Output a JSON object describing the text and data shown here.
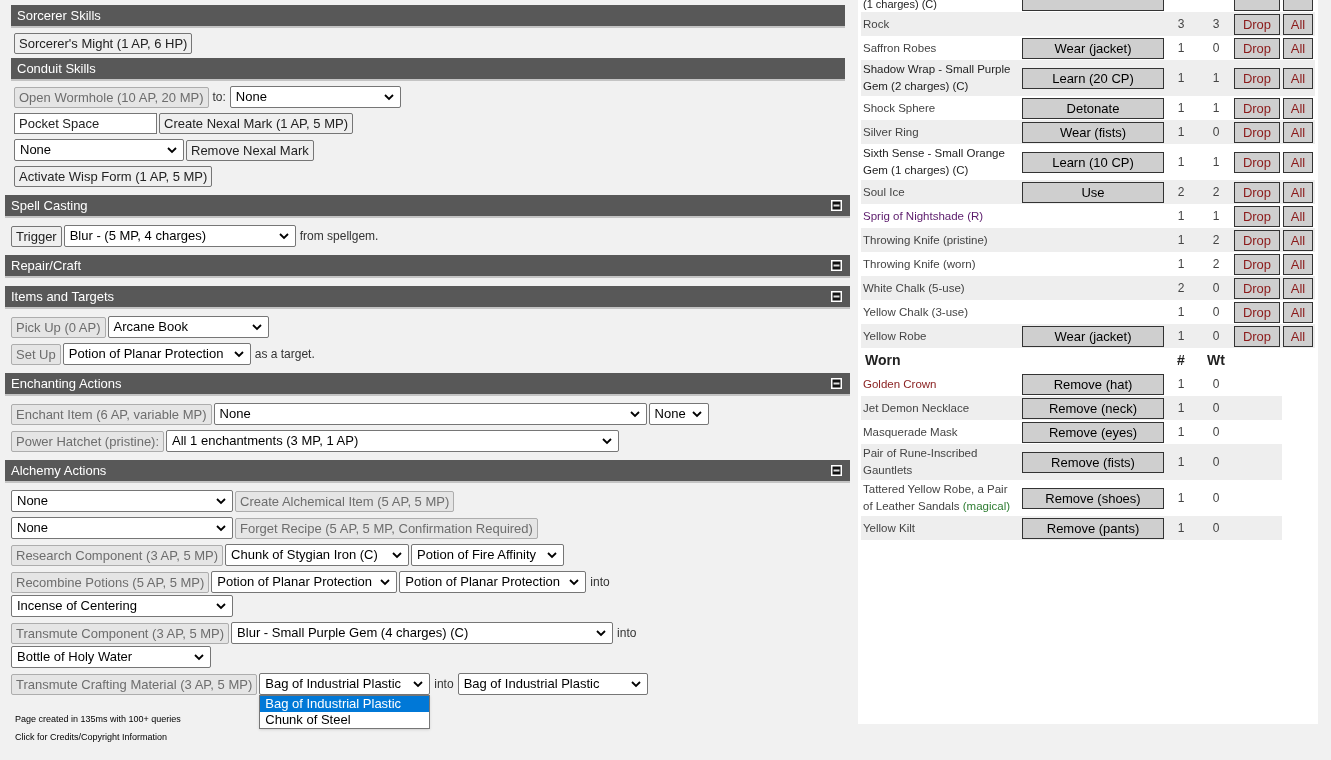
{
  "sections": [
    {
      "title": "Sorcerer Skills",
      "nested": true,
      "collapsible": false,
      "rows": [
        [
          {
            "kind": "button",
            "label": "Sorcerer's Might (1 AP, 6 HP)",
            "disabled": false
          }
        ]
      ]
    },
    {
      "title": "Conduit Skills",
      "nested": true,
      "collapsible": false,
      "rows": [
        [
          {
            "kind": "button",
            "label": "Open Wormhole (10 AP, 20 MP)",
            "disabled": true
          },
          {
            "kind": "text",
            "text": "to:"
          },
          {
            "kind": "select",
            "value": "None"
          }
        ],
        [
          {
            "kind": "input",
            "value": "Pocket Space"
          },
          {
            "kind": "button",
            "label": "Create Nexal Mark (1 AP, 5 MP)",
            "disabled": false
          }
        ],
        [
          {
            "kind": "select",
            "value": "None"
          },
          {
            "kind": "button",
            "label": "Remove Nexal Mark",
            "disabled": false
          }
        ],
        [
          {
            "kind": "button",
            "label": "Activate Wisp Form (1 AP, 5 MP)",
            "disabled": false
          }
        ]
      ]
    },
    {
      "title": "Spell Casting",
      "nested": false,
      "collapsible": true,
      "rows": [
        [
          {
            "kind": "button",
            "label": "Trigger",
            "disabled": false
          },
          {
            "kind": "select",
            "value": "Blur - (5 MP, 4 charges)"
          },
          {
            "kind": "text",
            "text": "from spellgem."
          }
        ]
      ]
    },
    {
      "title": "Repair/Craft",
      "nested": false,
      "collapsible": true
    },
    {
      "title": "Items and Targets",
      "nested": false,
      "collapsible": true,
      "rows": [
        [
          {
            "kind": "button",
            "label": "Pick Up (0 AP)",
            "disabled": true
          },
          {
            "kind": "select",
            "value": "Arcane Book"
          }
        ],
        [
          {
            "kind": "button",
            "label": "Set Up",
            "disabled": true
          },
          {
            "kind": "select",
            "value": "Potion of Planar Protection"
          },
          {
            "kind": "text",
            "text": "as a target."
          }
        ]
      ]
    },
    {
      "title": "Enchanting Actions",
      "nested": false,
      "collapsible": true,
      "rows": [
        [
          {
            "kind": "button",
            "label": "Enchant Item (6 AP, variable MP)",
            "disabled": true
          },
          {
            "kind": "select",
            "value": "None"
          },
          {
            "kind": "select",
            "value": "None"
          }
        ],
        [
          {
            "kind": "button",
            "label": "Power Hatchet (pristine):",
            "disabled": true
          },
          {
            "kind": "select",
            "value": "All 1 enchantments (3 MP, 1 AP)"
          }
        ]
      ]
    },
    {
      "title": "Alchemy Actions",
      "nested": false,
      "collapsible": true,
      "rows": [
        [
          {
            "kind": "select",
            "value": "None"
          },
          {
            "kind": "button",
            "label": "Create Alchemical Item (5 AP, 5 MP)",
            "disabled": true
          }
        ],
        [
          {
            "kind": "select",
            "value": "None"
          },
          {
            "kind": "button",
            "label": "Forget Recipe (5 AP, 5 MP, Confirmation Required)",
            "disabled": true
          }
        ],
        [
          {
            "kind": "button",
            "label": "Research Component (3 AP, 5 MP)",
            "disabled": true
          },
          {
            "kind": "select",
            "value": "Chunk of Stygian Iron (C)"
          },
          {
            "kind": "select",
            "value": "Potion of Fire Affinity"
          }
        ],
        [
          {
            "kind": "button",
            "label": "Recombine Potions (5 AP, 5 MP)",
            "disabled": true
          },
          {
            "kind": "select",
            "value": "Potion of Planar Protection"
          },
          {
            "kind": "select",
            "value": "Potion of Planar Protection"
          },
          {
            "kind": "text",
            "text": "into"
          },
          {
            "kind": "break"
          },
          {
            "kind": "select",
            "value": "Incense of Centering"
          }
        ],
        [
          {
            "kind": "button",
            "label": "Transmute Component (3 AP, 5 MP)",
            "disabled": true
          },
          {
            "kind": "select",
            "value": "Blur - Small Purple Gem (4 charges) (C)"
          },
          {
            "kind": "text",
            "text": "into"
          },
          {
            "kind": "break"
          },
          {
            "kind": "select",
            "value": "Bottle of Holy Water"
          }
        ],
        [
          {
            "kind": "button",
            "label": "Transmute Crafting Material (3 AP, 5 MP)",
            "disabled": true
          },
          {
            "kind": "select",
            "value": "Bag of Industrial Plastic",
            "open": true,
            "options": [
              {
                "label": "Bag of Industrial Plastic",
                "selected": true
              },
              {
                "label": "Chunk of Steel",
                "selected": false
              }
            ]
          },
          {
            "kind": "text",
            "text": "into"
          },
          {
            "kind": "select",
            "value": "Bag of Industrial Plastic"
          }
        ]
      ]
    }
  ],
  "footer": [
    "Page created in 135ms with 100+ queries",
    "Click for Credits/Copyright Information"
  ],
  "inventory": {
    "rows": [
      {
        "kind": "cut",
        "name": "(1 charges) (C)"
      },
      {
        "kind": "item",
        "name": "Rock",
        "count": "3",
        "weight": "3",
        "drop": "Drop",
        "all": "All"
      },
      {
        "kind": "item",
        "name": "Saffron Robes",
        "action": "Wear (jacket)",
        "count": "1",
        "weight": "0",
        "drop": "Drop",
        "all": "All"
      },
      {
        "kind": "item",
        "name": "Shadow Wrap - Small Purple Gem (2 charges) (C)",
        "color": "#222222",
        "action": "Learn (20 CP)",
        "count": "1",
        "weight": "1",
        "drop": "Drop",
        "all": "All"
      },
      {
        "kind": "item",
        "name": "Shock Sphere",
        "action": "Detonate",
        "count": "1",
        "weight": "1",
        "drop": "Drop",
        "all": "All"
      },
      {
        "kind": "item",
        "name": "Silver Ring",
        "action": "Wear (fists)",
        "count": "1",
        "weight": "0",
        "drop": "Drop",
        "all": "All"
      },
      {
        "kind": "item",
        "name": "Sixth Sense - Small Orange Gem (1 charges) (C)",
        "color": "#222222",
        "action": "Learn (10 CP)",
        "count": "1",
        "weight": "1",
        "drop": "Drop",
        "all": "All"
      },
      {
        "kind": "item",
        "name": "Soul Ice",
        "action": "Use",
        "count": "2",
        "weight": "2",
        "drop": "Drop",
        "all": "All"
      },
      {
        "kind": "item",
        "name": "Sprig of Nightshade (R)",
        "color": "#5b1a6b",
        "count": "1",
        "weight": "1",
        "drop": "Drop",
        "all": "All"
      },
      {
        "kind": "item",
        "name": "Throwing Knife (pristine)",
        "count": "1",
        "weight": "2",
        "drop": "Drop",
        "all": "All"
      },
      {
        "kind": "item",
        "name": "Throwing Knife (worn)",
        "count": "1",
        "weight": "2",
        "drop": "Drop",
        "all": "All"
      },
      {
        "kind": "item",
        "name": "White Chalk (5-use)",
        "count": "2",
        "weight": "0",
        "drop": "Drop",
        "all": "All"
      },
      {
        "kind": "item",
        "name": "Yellow Chalk (3-use)",
        "count": "1",
        "weight": "0",
        "drop": "Drop",
        "all": "All"
      },
      {
        "kind": "item",
        "name": "Yellow Robe",
        "action": "Wear (jacket)",
        "count": "1",
        "weight": "0",
        "drop": "Drop",
        "all": "All"
      }
    ],
    "worn_header": {
      "title": "Worn",
      "count": "#",
      "weight": "Wt"
    },
    "worn": [
      {
        "name": "Golden Crown",
        "color": "#8b2323",
        "action": "Remove (hat)",
        "count": "1",
        "weight": "0"
      },
      {
        "name": "Jet Demon Necklace",
        "action": "Remove (neck)",
        "count": "1",
        "weight": "0"
      },
      {
        "name": "Masquerade Mask",
        "action": "Remove (eyes)",
        "count": "1",
        "weight": "0"
      },
      {
        "name": "Pair of Rune-Inscribed Gauntlets",
        "action": "Remove (fists)",
        "count": "1",
        "weight": "0"
      },
      {
        "name": "Tattered Yellow Robe, a Pair of Leather Sandals",
        "tag": "(magical)",
        "action": "Remove (shoes)",
        "count": "1",
        "weight": "0"
      },
      {
        "name": "Yellow Kilt",
        "action": "Remove (pants)",
        "count": "1",
        "weight": "0"
      }
    ]
  }
}
